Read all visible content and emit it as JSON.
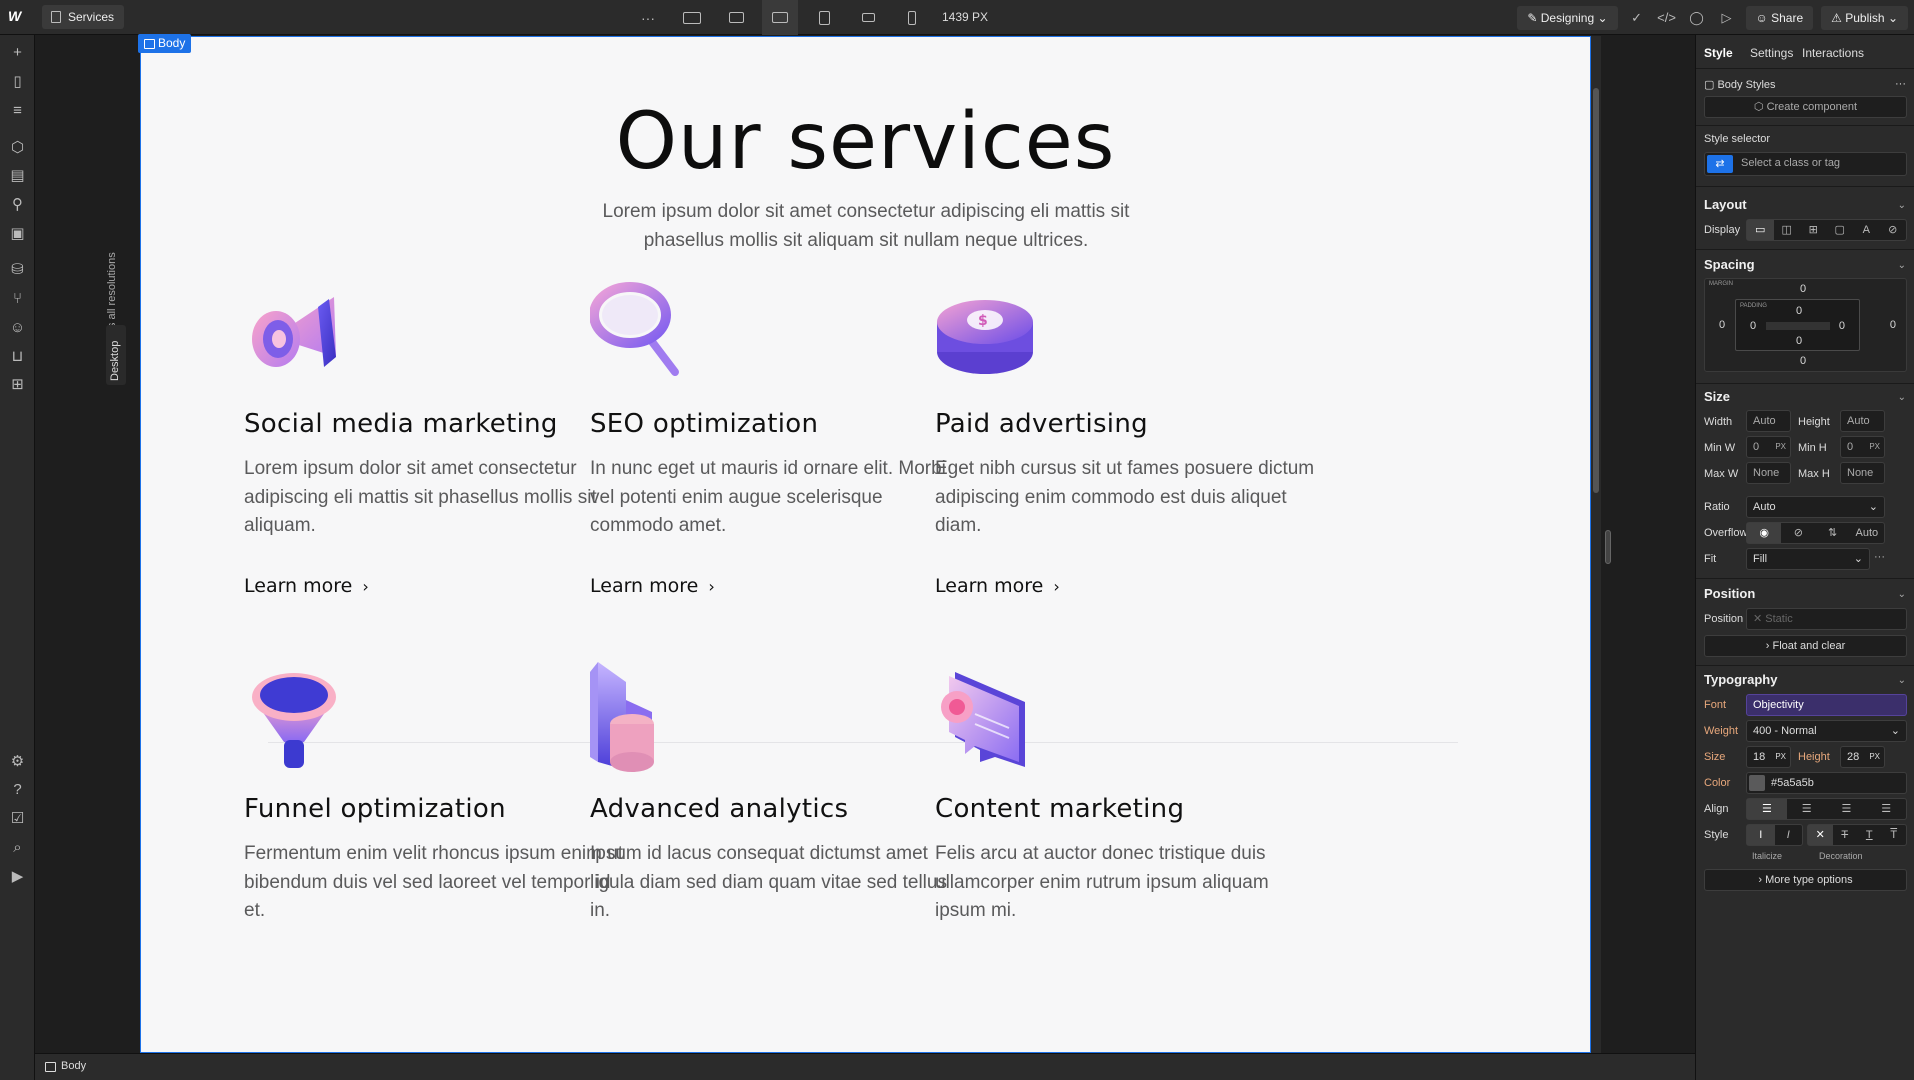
{
  "topbar": {
    "page_name": "Services",
    "more": "···",
    "width_readout": "1439 PX",
    "mode_label": "Designing",
    "share_label": "Share",
    "publish_label": "Publish"
  },
  "canvas": {
    "body_tag": "Body",
    "affects_label": "Affects all resolutions",
    "breakpoint_tag": "Desktop",
    "heading": "Our services",
    "lead": "Lorem ipsum dolor sit amet consectetur adipiscing eli mattis sit phasellus mollis sit aliquam sit nullam neque ultrices.",
    "cards": [
      {
        "title": "Social media marketing",
        "desc": "Lorem ipsum dolor sit amet consectetur adipiscing eli mattis sit phasellus mollis sit aliquam.",
        "link": "Learn more",
        "icon": "megaphone-icon"
      },
      {
        "title": "SEO optimization",
        "desc": "In nunc eget ut mauris id ornare elit. Morbi vel potenti enim augue scelerisque commodo amet.",
        "link": "Learn more",
        "icon": "magnifier-icon"
      },
      {
        "title": "Paid advertising",
        "desc": "Eget nibh cursus sit ut fames posuere dictum adipiscing enim commodo est duis aliquet diam.",
        "link": "Learn more",
        "icon": "coins-icon"
      },
      {
        "title": "Funnel optimization",
        "desc": "Fermentum enim velit rhoncus ipsum enim ut bibendum duis vel sed laoreet vel tempor id et.",
        "link": "Learn more",
        "icon": "funnel-icon"
      },
      {
        "title": "Advanced analytics",
        "desc": "Ipsum id lacus consequat dictumst amet ligula diam sed diam quam vitae sed tellus in.",
        "link": "Learn more",
        "icon": "analytics-icon"
      },
      {
        "title": "Content marketing",
        "desc": "Felis arcu at auctor donec tristique duis ullamcorper enim rutrum ipsum aliquam ipsum mi.",
        "link": "Learn more",
        "icon": "chat-bubble-icon"
      }
    ]
  },
  "statusbar": {
    "crumb": "Body"
  },
  "panel": {
    "tabs": [
      "Style",
      "Settings",
      "Interactions"
    ],
    "body_styles": "Body Styles",
    "create_component": "Create component",
    "style_selector": "Style selector",
    "selector_placeholder": "Select a class or tag",
    "layout": {
      "heading": "Layout",
      "display": "Display"
    },
    "spacing": {
      "heading": "Spacing",
      "margin_label": "MARGIN",
      "padding_label": "PADDING",
      "margin": {
        "top": "0",
        "right": "0",
        "bottom": "0",
        "left": "0"
      },
      "padding": {
        "top": "0",
        "right": "0",
        "bottom": "0",
        "left": "0"
      }
    },
    "size": {
      "heading": "Size",
      "width_label": "Width",
      "width": "Auto",
      "height_label": "Height",
      "height": "Auto",
      "minw_label": "Min W",
      "minw": "0",
      "minw_unit": "PX",
      "minh_label": "Min H",
      "minh": "0",
      "minh_unit": "PX",
      "maxw_label": "Max W",
      "maxw": "None",
      "maxh_label": "Max H",
      "maxh": "None",
      "ratio_label": "Ratio",
      "ratio": "Auto",
      "overflow_label": "Overflow",
      "overflow_auto": "Auto",
      "fit_label": "Fit",
      "fit": "Fill"
    },
    "position": {
      "heading": "Position",
      "label": "Position",
      "value": "Static",
      "float": "Float and clear"
    },
    "typography": {
      "heading": "Typography",
      "font_label": "Font",
      "font": "Objectivity",
      "weight_label": "Weight",
      "weight": "400 - Normal",
      "size_label": "Size",
      "size": "18",
      "size_unit": "PX",
      "lh_label": "Height",
      "lh": "28",
      "lh_unit": "PX",
      "color_label": "Color",
      "color": "#5a5a5b",
      "align_label": "Align",
      "style_label": "Style",
      "italicize": "Italicize",
      "decoration": "Decoration",
      "more": "More type options"
    }
  }
}
